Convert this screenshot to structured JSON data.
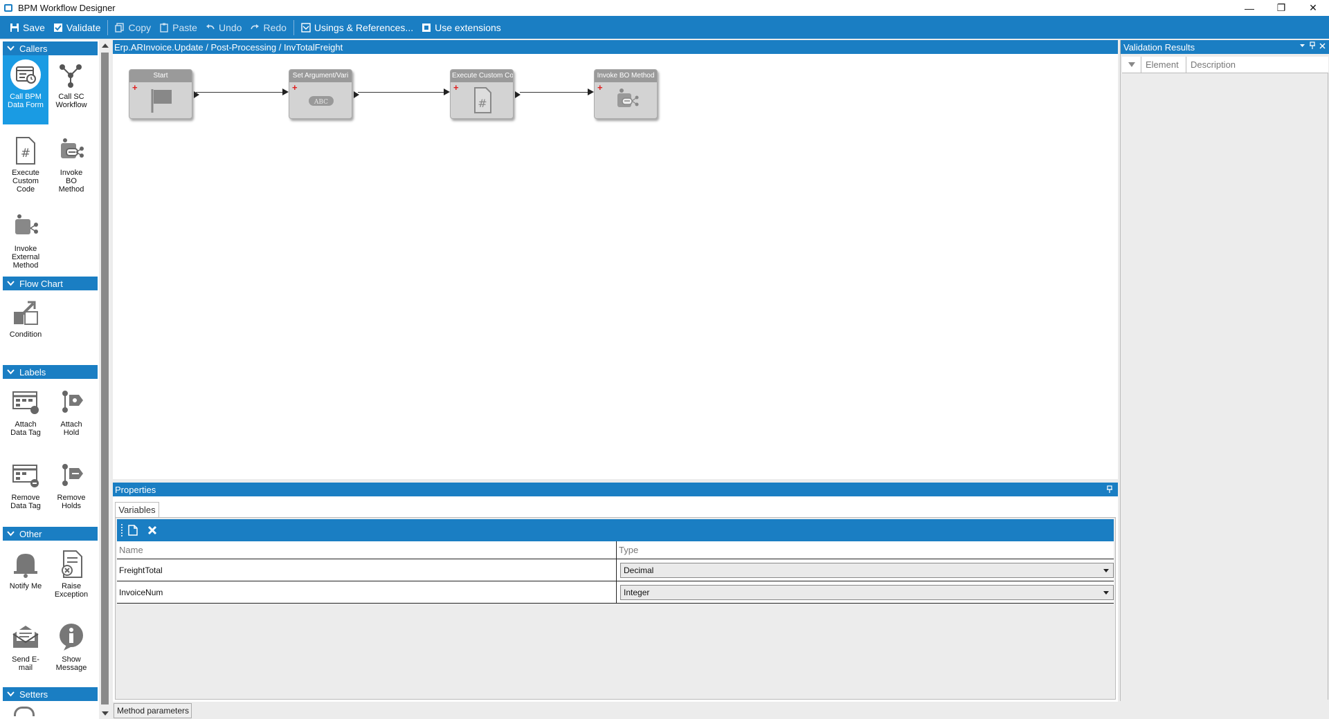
{
  "window": {
    "title": "BPM Workflow Designer",
    "controls": [
      "—",
      "❐",
      "✕"
    ]
  },
  "toolbar": {
    "save": "Save",
    "validate": "Validate",
    "copy": "Copy",
    "paste": "Paste",
    "undo": "Undo",
    "redo": "Redo",
    "usings": "Usings & References...",
    "extensions": "Use extensions"
  },
  "toolbox": {
    "groups": {
      "callers": "Callers",
      "flowchart": "Flow Chart",
      "labels": "Labels",
      "other": "Other",
      "setters": "Setters"
    },
    "tools": {
      "call_bpm_data_form": "Call BPM Data Form",
      "call_sc_workflow": "Call SC Workflow",
      "execute_custom_code": "Execute Custom Code",
      "invoke_bo_method": "Invoke BO Method",
      "invoke_external_method": "Invoke External Method",
      "condition": "Condition",
      "attach_data_tag": "Attach Data Tag",
      "attach_hold": "Attach Hold",
      "remove_data_tag": "Remove Data Tag",
      "remove_holds": "Remove Holds",
      "notify_me": "Notify Me",
      "raise_exception": "Raise Exception",
      "send_email": "Send E-mail",
      "show_message": "Show Message"
    }
  },
  "canvas": {
    "breadcrumb": "Erp.ARInvoice.Update / Post-Processing / InvTotalFreight",
    "nodes": {
      "start": "Start",
      "set_argument": "Set Argument/Vari",
      "execute_custom": "Execute Custom Co",
      "invoke_bo": "Invoke BO Method"
    },
    "abc_label": "ABC",
    "plus": "+"
  },
  "properties": {
    "title": "Properties",
    "tab": "Variables",
    "columns": {
      "name": "Name",
      "type": "Type"
    },
    "rows": [
      {
        "name": "FreightTotal",
        "type": "Decimal"
      },
      {
        "name": "InvoiceNum",
        "type": "Integer"
      }
    ],
    "bottom_tab": "Method parameters"
  },
  "validation": {
    "title": "Validation Results",
    "columns": {
      "element": "Element",
      "description": "Description"
    }
  },
  "colors": {
    "accent": "#1a7ec3",
    "selected": "#1a9be3",
    "node_header": "#9a9a9a",
    "node_body": "#d3d3d3"
  }
}
